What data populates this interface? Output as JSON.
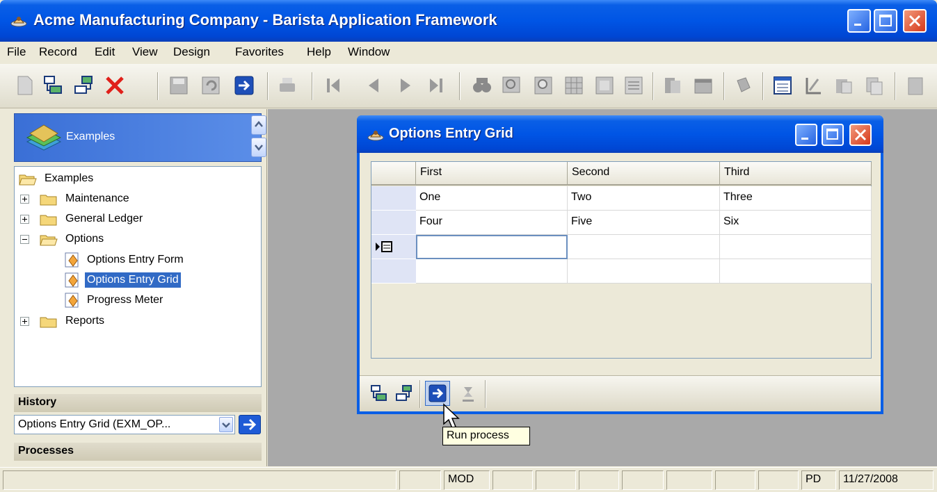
{
  "window": {
    "title": "Acme Manufacturing Company - Barista Application Framework",
    "controls": [
      "minimize-icon",
      "maximize-icon",
      "close-icon"
    ]
  },
  "menu": {
    "items": [
      "File",
      "Record",
      "Edit",
      "View",
      "Design",
      "Favorites",
      "Help",
      "Window"
    ]
  },
  "toolbar": {
    "buttons": [
      "new-record-icon",
      "insert-icon",
      "copy-record-icon",
      "delete-icon",
      "save-icon",
      "undo-icon",
      "run-process-icon",
      "print-icon",
      "first-record-icon",
      "previous-record-icon",
      "next-record-icon",
      "last-record-icon",
      "find-icon",
      "lookup-icon",
      "zoom-icon",
      "grid-icon",
      "form-icon",
      "report-icon",
      "chart-icon",
      "notes-icon",
      "calculator-icon",
      "design-icon",
      "paste-icon",
      "copy-icon"
    ]
  },
  "navigator": {
    "selector_label": "Examples",
    "tree": {
      "root": "Examples",
      "items": [
        {
          "label": "Maintenance",
          "type": "folder",
          "expanded": false
        },
        {
          "label": "General Ledger",
          "type": "folder",
          "expanded": false
        },
        {
          "label": "Options",
          "type": "folder",
          "expanded": true
        },
        {
          "label": "Options Entry Form",
          "type": "form"
        },
        {
          "label": "Options Entry Grid",
          "type": "form",
          "selected": true
        },
        {
          "label": "Progress Meter",
          "type": "form"
        },
        {
          "label": "Reports",
          "type": "folder",
          "expanded": false
        }
      ]
    },
    "history_label": "History",
    "history_value": "Options Entry Grid (EXM_OP...",
    "processes_label": "Processes"
  },
  "child_window": {
    "title": "Options Entry Grid",
    "grid": {
      "columns": [
        "First",
        "Second",
        "Third"
      ],
      "rows": [
        [
          "One",
          "Two",
          "Three"
        ],
        [
          "Four",
          "Five",
          "Six"
        ],
        [
          "",
          "",
          ""
        ],
        [
          "",
          "",
          ""
        ]
      ]
    },
    "toolbar_buttons": [
      "insert-row-icon",
      "copy-row-icon",
      "run-process-icon",
      "clear-icon"
    ]
  },
  "tooltip": "Run process",
  "status": {
    "mode": "MOD",
    "code": "PD",
    "date": "11/27/2008"
  },
  "colors": {
    "titlebar_blue": "#0055e5",
    "selection_blue": "#316ac5",
    "close_red": "#d6381a",
    "mdi_gray": "#a9a9a9"
  }
}
